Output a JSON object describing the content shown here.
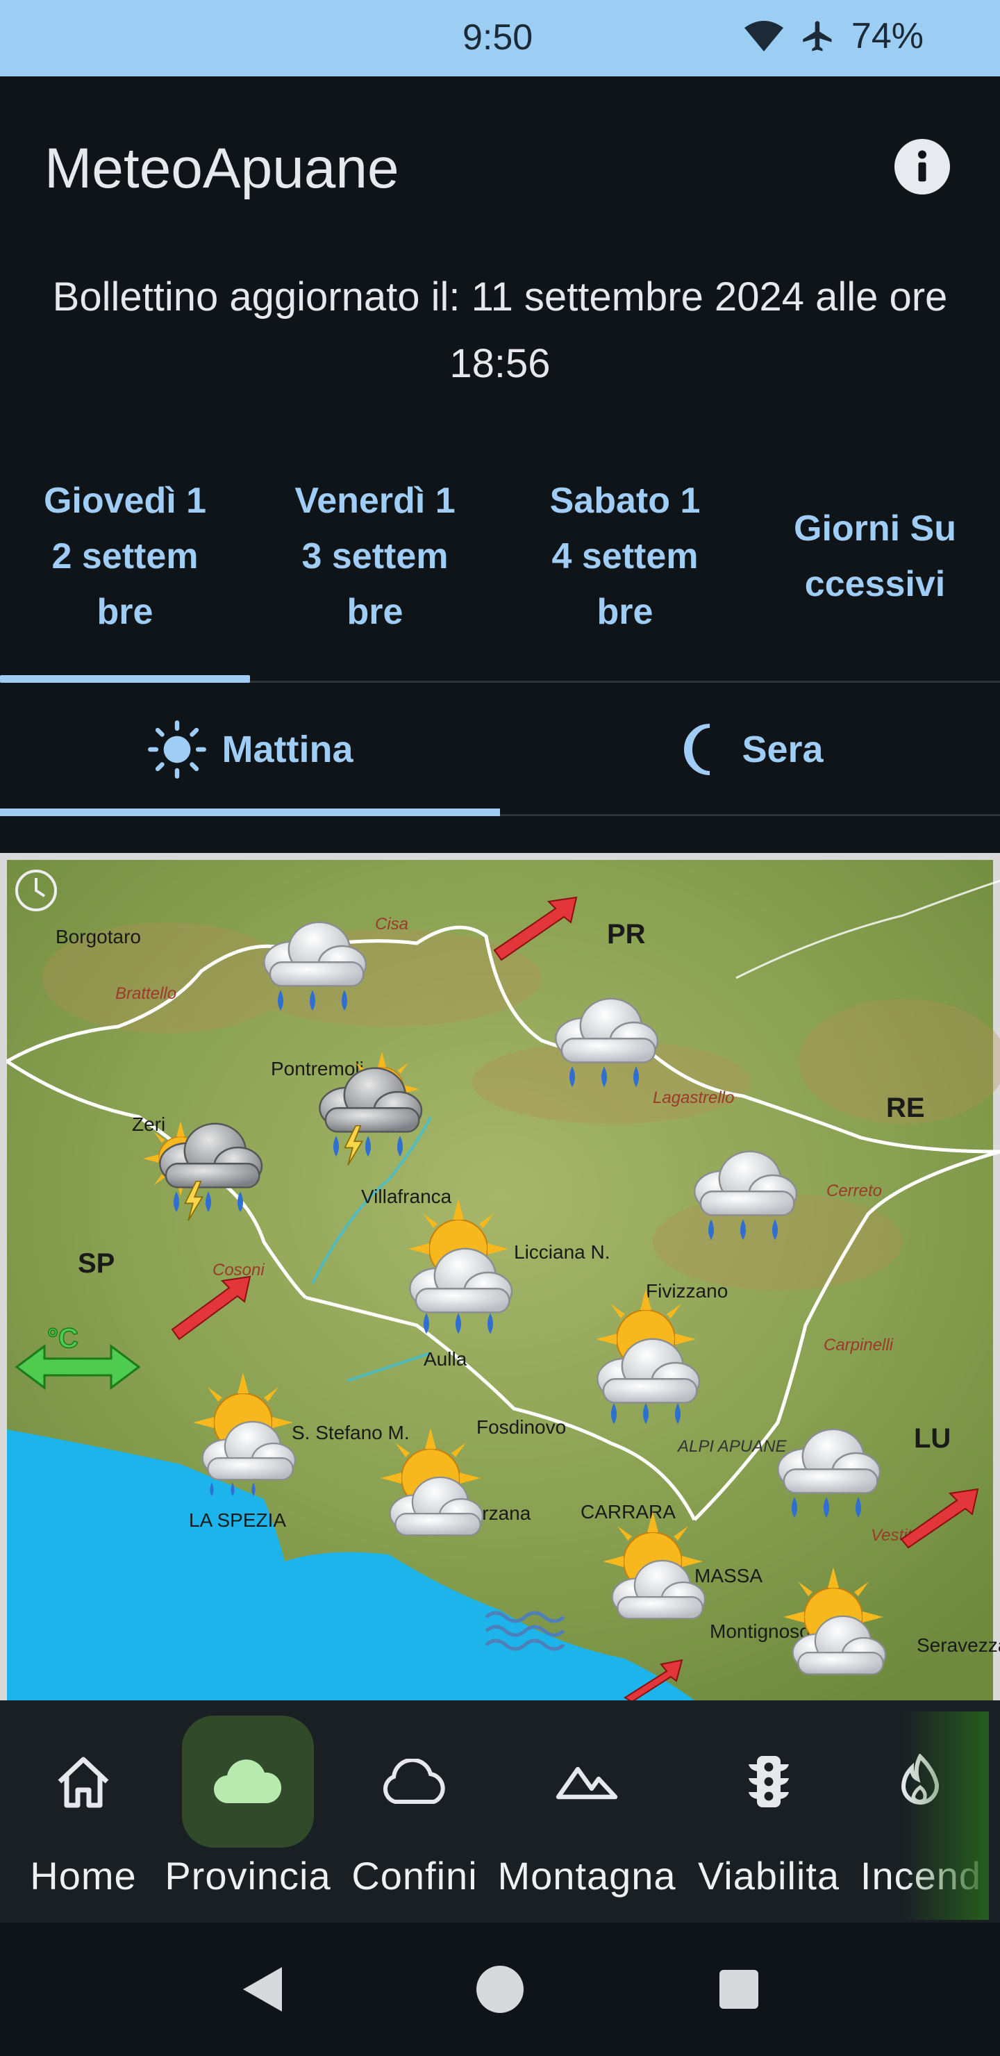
{
  "status_bar": {
    "time": "9:50",
    "battery": "74%",
    "icons": [
      "wifi-icon",
      "airplane-icon"
    ]
  },
  "header": {
    "title": "MeteoApuane",
    "info_icon": "info-icon"
  },
  "bulletin": "Bollettino aggiornato il: 11 settembre 2024 alle ore 18:56",
  "day_tabs": [
    {
      "label": "Giovedì 12 settembre",
      "selected": true
    },
    {
      "label": "Venerdì 13 settembre",
      "selected": false
    },
    {
      "label": "Sabato 14 settembre",
      "selected": false
    },
    {
      "label": "Giorni Successivi",
      "selected": false
    }
  ],
  "period_tabs": [
    {
      "label": "Mattina",
      "icon": "sun-icon",
      "selected": true
    },
    {
      "label": "Sera",
      "icon": "moon-icon",
      "selected": false
    }
  ],
  "map": {
    "place_labels": [
      "Borgotaro",
      "Cisa",
      "Brattello",
      "PR",
      "Pontremoli",
      "Zeri",
      "Lagastrello",
      "RE",
      "Villafranca",
      "Cerreto",
      "SP",
      "Licciana N.",
      "Cosoni",
      "Fivizzano",
      "Carpinelli",
      "Aulla",
      "S. Stefano M.",
      "Fosdinovo",
      "ALPI APUANE",
      "LU",
      "LA SPEZIA",
      "Sarzana",
      "CARRARA",
      "MASSA",
      "Vestito",
      "Montignoso",
      "Seravezza"
    ],
    "temperature_symbol": "°C",
    "colors": {
      "sea": "#1cb4ea",
      "land": "#8aa152",
      "border": "#ffffff"
    }
  },
  "bottom_nav": [
    {
      "label": "Home",
      "icon": "home-icon",
      "selected": false
    },
    {
      "label": "Provincia",
      "icon": "cloud-filled-icon",
      "selected": true
    },
    {
      "label": "Confini",
      "icon": "cloud-outline-icon",
      "selected": false
    },
    {
      "label": "Montagna",
      "icon": "mountain-icon",
      "selected": false
    },
    {
      "label": "Viabilita",
      "icon": "traffic-light-icon",
      "selected": false
    },
    {
      "label": "Incend",
      "icon": "fire-icon",
      "selected": false
    }
  ],
  "system_nav": [
    "back-button",
    "home-button",
    "recents-button"
  ],
  "colors": {
    "accent": "#9fcdf5",
    "background": "#0f1418",
    "status_bar": "#9ccdf2",
    "nav_active": "#304a2a"
  }
}
